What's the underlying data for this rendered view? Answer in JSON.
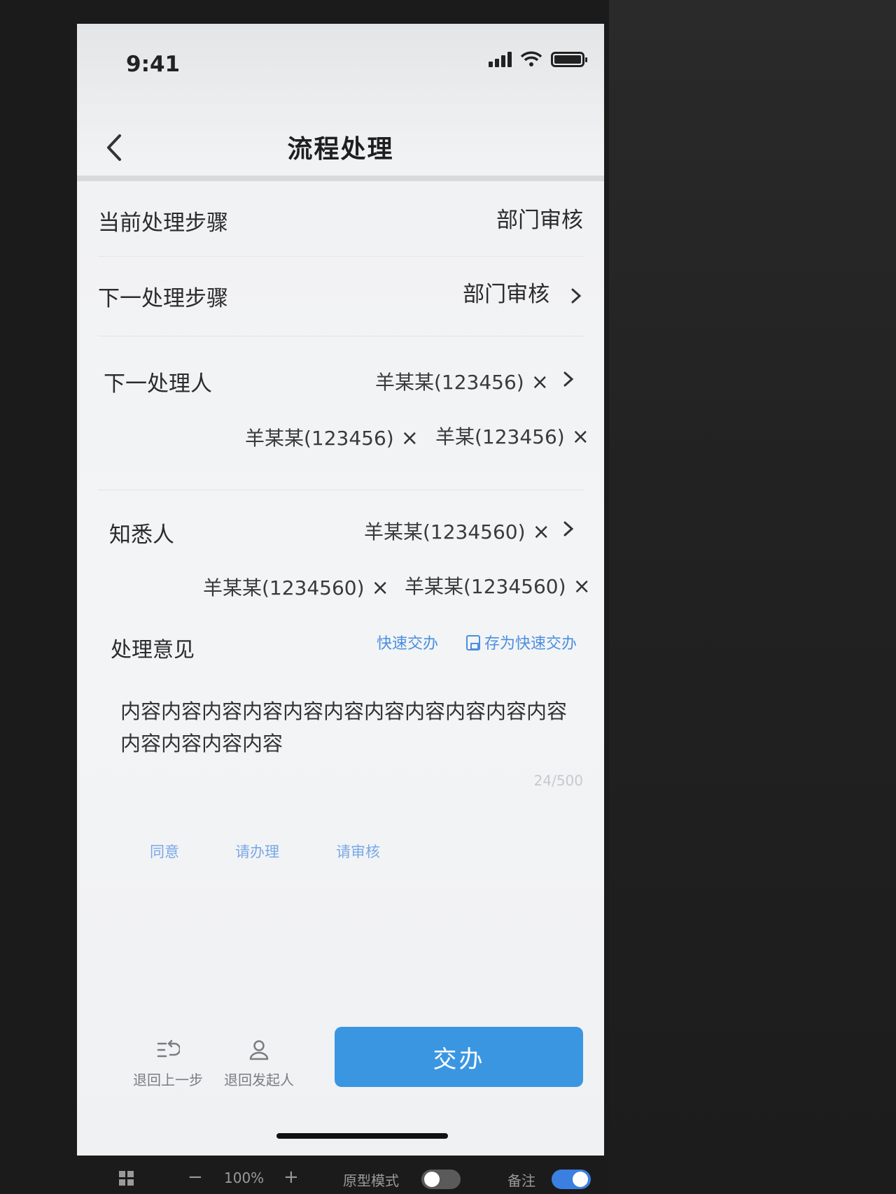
{
  "status_bar": {
    "time": "9:41"
  },
  "nav": {
    "title": "流程处理"
  },
  "fields": {
    "current_step": {
      "label": "当前处理步骤",
      "value": "部门审核"
    },
    "next_step": {
      "label": "下一处理步骤",
      "value": "部门审核"
    },
    "next_handler": {
      "label": "下一处理人",
      "chips": [
        "羊某某(123456)",
        "羊某某(123456)",
        "羊某(123456)"
      ]
    },
    "cc": {
      "label": "知悉人",
      "chips": [
        "羊某某(1234560)",
        "羊某某(1234560)",
        "羊某某(1234560)"
      ]
    }
  },
  "opinion": {
    "label": "处理意见",
    "quick_action": "快速交办",
    "save_quick": "存为快速交办",
    "content": "内容内容内容内容内容内容内容内容内容内容内容内容内容内容内容",
    "counter": "24/500",
    "tags": [
      "同意",
      "请办理",
      "请审核"
    ]
  },
  "bottom_bar": {
    "back_step": "退回上一步",
    "back_initiator": "退回发起人",
    "submit": "交办"
  },
  "prototype_toolbar": {
    "zoom": "100%",
    "minus": "−",
    "plus": "+",
    "prototype_mode": "原型模式",
    "notes": "备注"
  },
  "icons": {
    "close": "×",
    "accent_color": "#3b96e2"
  }
}
